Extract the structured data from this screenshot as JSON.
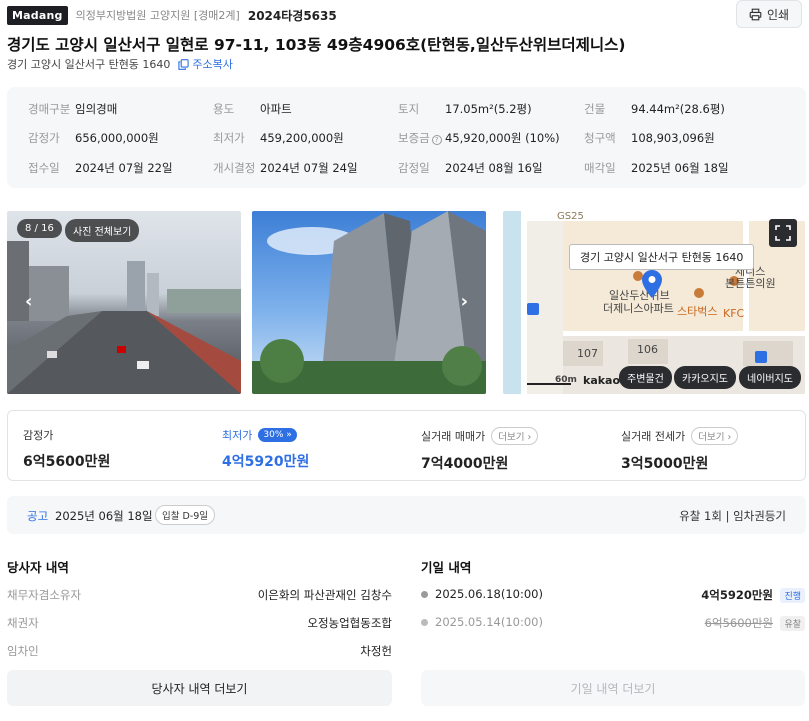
{
  "header": {
    "logo": "Madang",
    "court": "의정부지방법원 고양지원 [경매2계]",
    "case_no": "2024타경5635",
    "print_label": "인쇄"
  },
  "property": {
    "title": "경기도 고양시 일산서구 일현로 97-11, 103동 49층4906호(탄현동,일산두산위브더제니스)",
    "jibun": "경기 고양시 일산서구 탄현동 1640",
    "copy_label": "주소복사"
  },
  "info": [
    {
      "label": "경매구분",
      "value": "임의경매"
    },
    {
      "label": "용도",
      "value": "아파트"
    },
    {
      "label": "토지",
      "value": "17.05m²(5.2평)"
    },
    {
      "label": "건물",
      "value": "94.44m²(28.6평)"
    },
    {
      "label": "감정가",
      "value": "656,000,000원"
    },
    {
      "label": "최저가",
      "value": "459,200,000원"
    },
    {
      "label": "보증금",
      "value": "45,920,000원 (10%)"
    },
    {
      "label": "청구액",
      "value": "108,903,096원"
    },
    {
      "label": "접수일",
      "value": "2024년 07월 22일"
    },
    {
      "label": "개시결정",
      "value": "2024년 07월 24일"
    },
    {
      "label": "감정일",
      "value": "2024년 08월 16일"
    },
    {
      "label": "매각일",
      "value": "2025년 06월 18일"
    }
  ],
  "gallery": {
    "counter": "8 / 16",
    "view_all": "사진 전체보기"
  },
  "map": {
    "address_tag": "경기 고양시 일산서구 탄현동 1640",
    "labels": {
      "gs25": "GS25",
      "apt": "일산두산위브",
      "apt2": "더제니스아파트",
      "starbucks": "스타벅스",
      "kfc": "KFC",
      "clinic": "제니스",
      "clinic2": "본튼튼의원",
      "b107": "107",
      "b106": "106",
      "scale": "60m",
      "kakao": "kakao"
    },
    "buttons": [
      "주변물건",
      "카카오지도",
      "네이버지도"
    ]
  },
  "prices": [
    {
      "label": "감정가",
      "value": "6억5600만원"
    },
    {
      "label": "최저가",
      "badge": "30%",
      "value": "4억5920만원"
    },
    {
      "label": "실거래 매매가",
      "more": "더보기",
      "value": "7억4000만원"
    },
    {
      "label": "실거래 전세가",
      "more": "더보기",
      "value": "3억5000만원"
    }
  ],
  "notice": {
    "label": "공고",
    "date": "2025년 06월 18일",
    "dday": "입찰 D-9일",
    "right": "유찰 1회  |  임차권등기"
  },
  "parties": {
    "title": "당사자 내역",
    "rows": [
      {
        "role": "채무자겸소유자",
        "name": "이은화의 파산관재인 김창수"
      },
      {
        "role": "채권자",
        "name": "오정농업협동조합"
      },
      {
        "role": "임차인",
        "name": "차정헌"
      }
    ],
    "more_label": "당사자 내역 더보기"
  },
  "history": {
    "title": "기일 내역",
    "rows": [
      {
        "date": "2025.06.18(10:00)",
        "amount": "4억5920만원",
        "status": "진행"
      },
      {
        "date": "2025.05.14(10:00)",
        "amount": "6억5600만원",
        "status": "유찰"
      }
    ],
    "more_label": "기일 내역 더보기"
  }
}
